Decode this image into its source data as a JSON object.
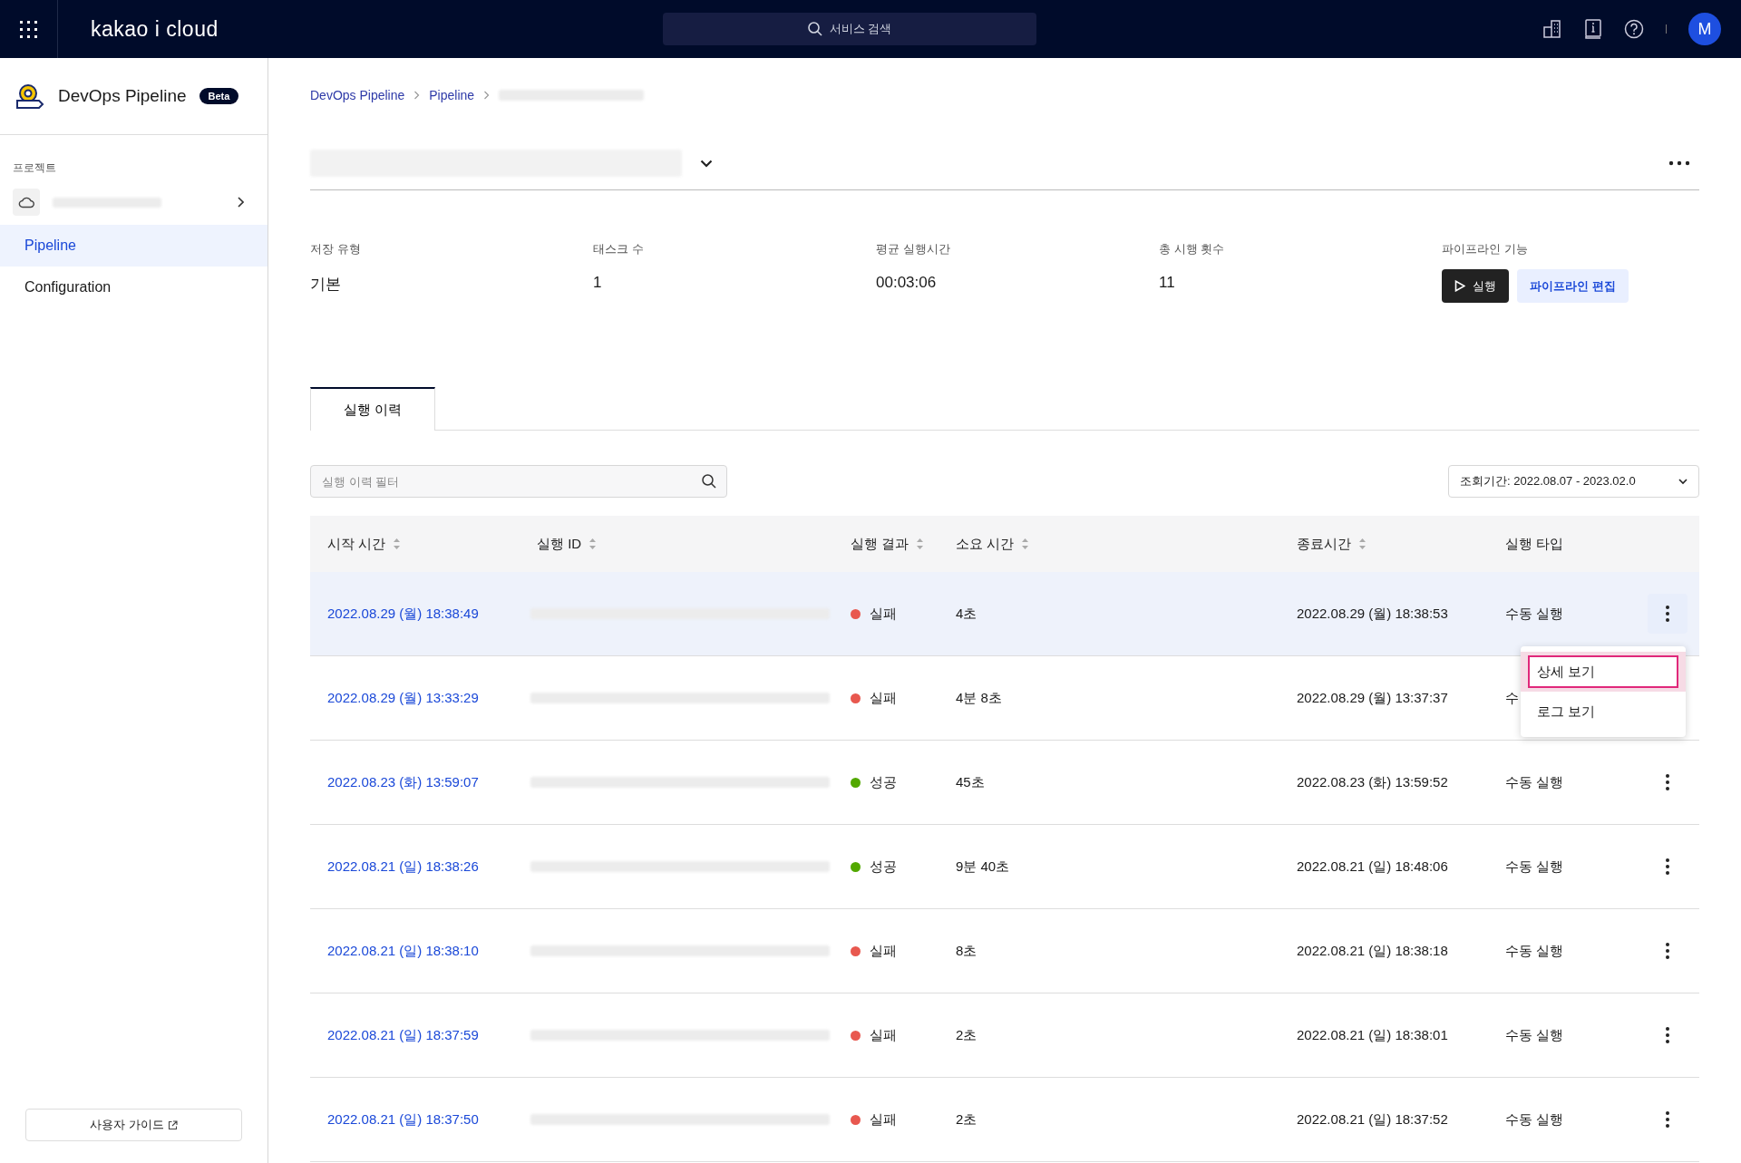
{
  "topbar": {
    "logo": "kakao i cloud",
    "search_placeholder": "서비스 검색",
    "avatar": "M"
  },
  "sidebar": {
    "title": "DevOps Pipeline",
    "badge": "Beta",
    "section_label": "프로젝트",
    "items": [
      {
        "label": "Pipeline",
        "selected": true
      },
      {
        "label": "Configuration",
        "selected": false
      }
    ],
    "guide_button": "사용자 가이드"
  },
  "breadcrumb": [
    "DevOps Pipeline",
    "Pipeline"
  ],
  "stats": [
    {
      "label": "저장 유형",
      "value": "기본"
    },
    {
      "label": "태스크 수",
      "value": "1"
    },
    {
      "label": "평균 실행시간",
      "value": "00:03:06"
    },
    {
      "label": "총 시행 횟수",
      "value": "11"
    }
  ],
  "actions": {
    "label": "파이프라인 기능",
    "buttons": [
      {
        "label": "실행",
        "kind": "primary"
      },
      {
        "label": "파이프라인 편집",
        "kind": "secondary"
      }
    ]
  },
  "tabs": [
    {
      "label": "실행 이력",
      "selected": true
    }
  ],
  "filter": {
    "placeholder": "실행 이력 필터"
  },
  "period_select": "조회기간: 2022.08.07 - 2023.02.0",
  "table": {
    "columns": [
      {
        "label": "시작 시간",
        "sortable": true
      },
      {
        "label": "실행 ID",
        "sortable": true
      },
      {
        "label": "실행 결과",
        "sortable": true
      },
      {
        "label": "소요 시간",
        "sortable": true
      },
      {
        "label": "종료시간",
        "sortable": true
      },
      {
        "label": "실행 타입",
        "sortable": false
      }
    ],
    "rows": [
      {
        "start": "2022.08.29 (월) 18:38:49",
        "color": "#e8584f",
        "result": "실패",
        "duration": "4초",
        "end": "2022.08.29 (월) 18:38:53",
        "type": "수동 실행",
        "selected": true
      },
      {
        "start": "2022.08.29 (월) 13:33:29",
        "color": "#e8584f",
        "result": "실패",
        "duration": "4분 8초",
        "end": "2022.08.29 (월) 13:37:37",
        "type": "수",
        "selected": false
      },
      {
        "start": "2022.08.23 (화) 13:59:07",
        "color": "#52a800",
        "result": "성공",
        "duration": "45초",
        "end": "2022.08.23 (화) 13:59:52",
        "type": "수동 실행",
        "selected": false
      },
      {
        "start": "2022.08.21 (일) 18:38:26",
        "color": "#52a800",
        "result": "성공",
        "duration": "9분 40초",
        "end": "2022.08.21 (일) 18:48:06",
        "type": "수동 실행",
        "selected": false
      },
      {
        "start": "2022.08.21 (일) 18:38:10",
        "color": "#e8584f",
        "result": "실패",
        "duration": "8초",
        "end": "2022.08.21 (일) 18:38:18",
        "type": "수동 실행",
        "selected": false
      },
      {
        "start": "2022.08.21 (일) 18:37:59",
        "color": "#e8584f",
        "result": "실패",
        "duration": "2초",
        "end": "2022.08.21 (일) 18:38:01",
        "type": "수동 실행",
        "selected": false
      },
      {
        "start": "2022.08.21 (일) 18:37:50",
        "color": "#e8584f",
        "result": "실패",
        "duration": "2초",
        "end": "2022.08.21 (일) 18:37:52",
        "type": "수동 실행",
        "selected": false
      }
    ]
  },
  "row_menu": {
    "items": [
      {
        "label": "상세 보기",
        "focused": true
      },
      {
        "label": "로그 보기",
        "focused": false
      }
    ]
  }
}
